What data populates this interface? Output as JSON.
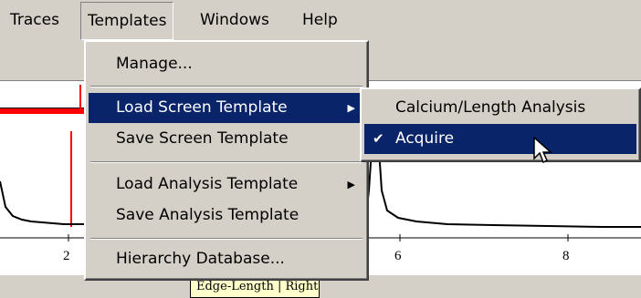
{
  "menubar": {
    "items": [
      {
        "label": "Traces"
      },
      {
        "label": "Templates"
      },
      {
        "label": "Windows"
      },
      {
        "label": "Help"
      }
    ]
  },
  "templates_menu": {
    "items": [
      {
        "label": "Manage..."
      },
      {
        "label": "Load Screen Template",
        "submenu": true
      },
      {
        "label": "Save Screen Template"
      },
      {
        "label": "Load Analysis Template",
        "submenu": true
      },
      {
        "label": "Save Analysis Template"
      },
      {
        "label": "Hierarchy Database..."
      }
    ]
  },
  "load_screen_submenu": {
    "items": [
      {
        "label": "Calcium/Length Analysis",
        "checked": false
      },
      {
        "label": "Acquire",
        "checked": true
      }
    ]
  },
  "plot": {
    "x_ticks": [
      "2",
      "6",
      "8"
    ]
  },
  "status": {
    "label": "Edge-Length | Right"
  },
  "colors": {
    "menu_bg": "#d4d0c8",
    "highlight": "#0a246a",
    "trace": "#000000",
    "marker": "#ff0000"
  },
  "icons": {
    "submenu_arrow": "triangle-right",
    "check": "checkmark",
    "cursor": "arrow-pointer"
  }
}
